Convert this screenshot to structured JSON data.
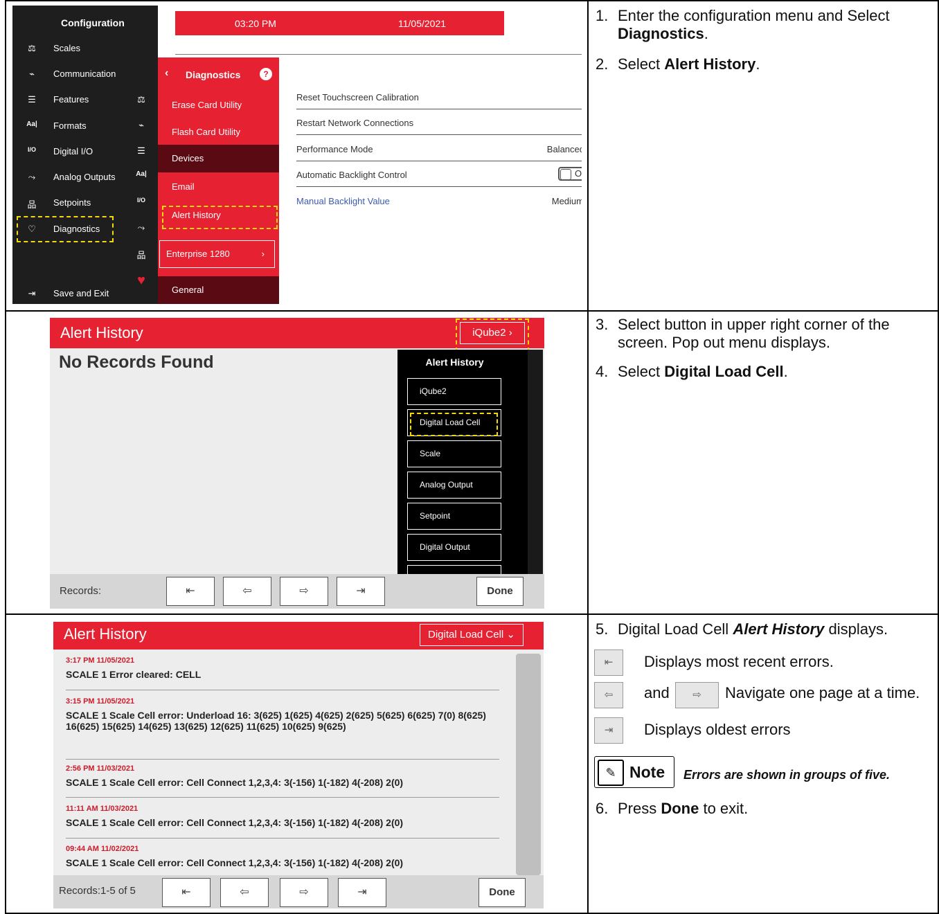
{
  "panel1": {
    "sidebar_title": "Configuration",
    "sidebar_items": [
      {
        "icon": "⚖",
        "label": "Scales"
      },
      {
        "icon": "⌁",
        "label": "Communication"
      },
      {
        "icon": "☰",
        "label": "Features"
      },
      {
        "icon": "Aa|",
        "label": "Formats"
      },
      {
        "icon": "I/O",
        "label": "Digital I/O"
      },
      {
        "icon": "⤳",
        "label": "Analog Outputs"
      },
      {
        "icon": "品",
        "label": "Setpoints"
      },
      {
        "icon": "♡",
        "label": "Diagnostics"
      }
    ],
    "save_exit": {
      "icon": "⇥",
      "label": "Save and Exit"
    },
    "icon_column": [
      "⚖",
      "⌁",
      "☰",
      "Aa|",
      "I/O",
      "⤳",
      "品",
      "♥"
    ],
    "time": "03:20 PM",
    "date": "11/05/2021",
    "diag_title": "Diagnostics",
    "diag_back": "‹",
    "diag_help": "?",
    "diag_items": [
      "Erase Card Utility",
      "Flash Card Utility",
      "Devices",
      "Email",
      "Alert History"
    ],
    "enterprise": "Enterprise 1280",
    "enterprise_chevron": "›",
    "general": "General",
    "settings": [
      {
        "label": "Reset Touchscreen Calibration",
        "value": ""
      },
      {
        "label": "Restart Network Connections",
        "value": ""
      },
      {
        "label": "Performance Mode",
        "value": "Balanced"
      },
      {
        "label": "Automatic Backlight Control",
        "value": "O"
      },
      {
        "label": "Manual Backlight Value",
        "value": "Medium"
      }
    ]
  },
  "panel2": {
    "title": "Alert History",
    "device_button": "iQube2  ›",
    "no_records": "No Records Found",
    "popout_title": "Alert History",
    "popout_items": [
      "iQube2",
      "Digital Load Cell",
      "Scale",
      "Analog Output",
      "Setpoint",
      "Digital Output"
    ],
    "records_label": "Records:",
    "nav": [
      "⇤",
      "⇦",
      "⇨",
      "⇥"
    ],
    "done": "Done"
  },
  "panel3": {
    "title": "Alert History",
    "device_button": "Digital Load Cell ⌄",
    "entries": [
      {
        "ts": "3:17 PM 11/05/2021",
        "msg": "SCALE 1 Error cleared: CELL"
      },
      {
        "ts": "3:15 PM 11/05/2021",
        "msg": "SCALE 1 Scale Cell error: Underload 16: 3(625) 1(625) 4(625) 2(625) 5(625) 6(625) 7(0) 8(625) 16(625) 15(625) 14(625) 13(625) 12(625) 11(625) 10(625) 9(625)"
      },
      {
        "ts": "2:56 PM 11/03/2021",
        "msg": "SCALE 1 Scale Cell error: Cell Connect 1,2,3,4: 3(-156) 1(-182) 4(-208) 2(0)"
      },
      {
        "ts": "11:11 AM 11/03/2021",
        "msg": "SCALE 1 Scale Cell error: Cell Connect 1,2,3,4: 3(-156) 1(-182) 4(-208) 2(0)"
      },
      {
        "ts": "09:44 AM 11/02/2021",
        "msg": "SCALE 1 Scale Cell error: Cell Connect 1,2,3,4: 3(-156) 1(-182) 4(-208) 2(0)"
      }
    ],
    "records_label": "Records:1-5 of 5",
    "nav": [
      "⇤",
      "⇦",
      "⇨",
      "⇥"
    ],
    "done": "Done"
  },
  "instructions": {
    "s1_num": "1.",
    "s1_pre": "Enter the configuration menu and Select ",
    "s1_bold": "Diagnostics",
    "s1_post": ".",
    "s2_num": "2.",
    "s2_pre": "Select ",
    "s2_bold": "Alert History",
    "s2_post": ".",
    "s3_num": "3.",
    "s3_text": "Select button in upper right corner of the screen. Pop out menu displays.",
    "s4_num": "4.",
    "s4_pre": "Select ",
    "s4_bold": "Digital Load Cell",
    "s4_post": ".",
    "s5_num": "5.",
    "s5_pre": "Digital Load Cell ",
    "s5_bold": "Alert History",
    "s5_post": " displays.",
    "k1": "Displays most recent errors.",
    "k2_and": "and",
    "k2": "Navigate one page at a time.",
    "k3": "Displays oldest errors",
    "note_label": "Note",
    "note_text": "Errors are shown in groups of five.",
    "s6_num": "6.",
    "s6_pre": "Press ",
    "s6_bold": "Done",
    "s6_post": " to exit.",
    "key_icons": [
      "⇤",
      "⇦",
      "⇨",
      "⇥"
    ]
  }
}
